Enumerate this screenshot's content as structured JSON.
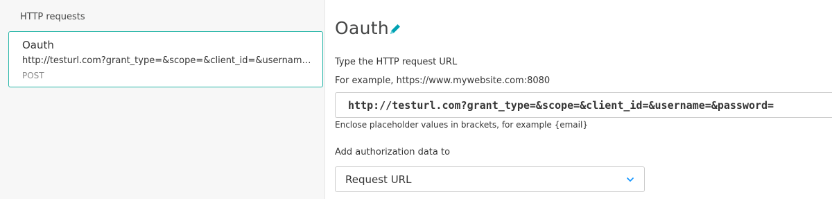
{
  "sidebar": {
    "title": "HTTP requests",
    "items": [
      {
        "name": "Oauth",
        "url": "http://testurl.com?grant_type=&scope=&client_id=&username=&password=",
        "method": "POST"
      }
    ]
  },
  "main": {
    "title": "Oauth",
    "url_label": "Type the HTTP request URL",
    "url_example": "For example, https://www.mywebsite.com:8080",
    "url_value": "http://testurl.com?grant_type=&scope=&client_id=&username=&password=",
    "url_hint": "Enclose placeholder values in brackets, for example {email}",
    "auth_label": "Add authorization data to",
    "auth_selected": "Request URL"
  },
  "colors": {
    "accent": "#2ab6a9",
    "edit_icon": "#00a1b2",
    "chevron": "#1496ff"
  },
  "icons": {
    "edit": "pencil-icon",
    "dropdown": "chevron-down-icon"
  }
}
